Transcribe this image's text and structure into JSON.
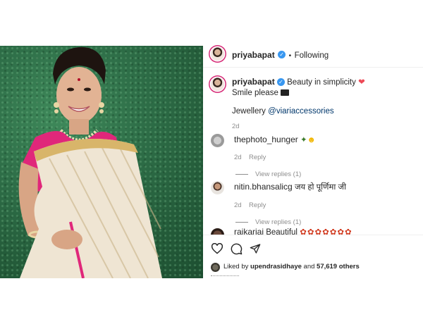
{
  "post": {
    "author": {
      "username": "priyabapat",
      "follow_dot": "•",
      "follow_label": "Following"
    },
    "caption": {
      "username": "priyabapat",
      "line1": "Beauty in simplicity",
      "line2": "Smile please",
      "line3_prefix": "Jewellery",
      "mention": "@viariaccessories",
      "time": "2d"
    },
    "comments": [
      {
        "username": "thephoto_hunger",
        "text": "",
        "time": "2d",
        "reply_label": "Reply",
        "view_replies": "View replies (1)"
      },
      {
        "username": "nitin.bhansalicg",
        "text": "जय हो पूर्णिमा जी",
        "time": "2d",
        "reply_label": "Reply",
        "view_replies": "View replies (1)"
      },
      {
        "username": "raikariai",
        "text": "Beautiful"
      }
    ],
    "likes": {
      "prefix": "Liked by",
      "user": "upendrasidhaye",
      "middle": "and",
      "count": "57,619",
      "suffix": "others"
    },
    "colors": {
      "accent_link": "#00376b",
      "verified": "#3897f0",
      "heart": "#ed4956",
      "ring": "#d62976"
    },
    "icons": [
      "verified-badge-icon",
      "heart-icon",
      "clapper-icon",
      "like-icon",
      "comment-icon",
      "share-icon"
    ]
  }
}
